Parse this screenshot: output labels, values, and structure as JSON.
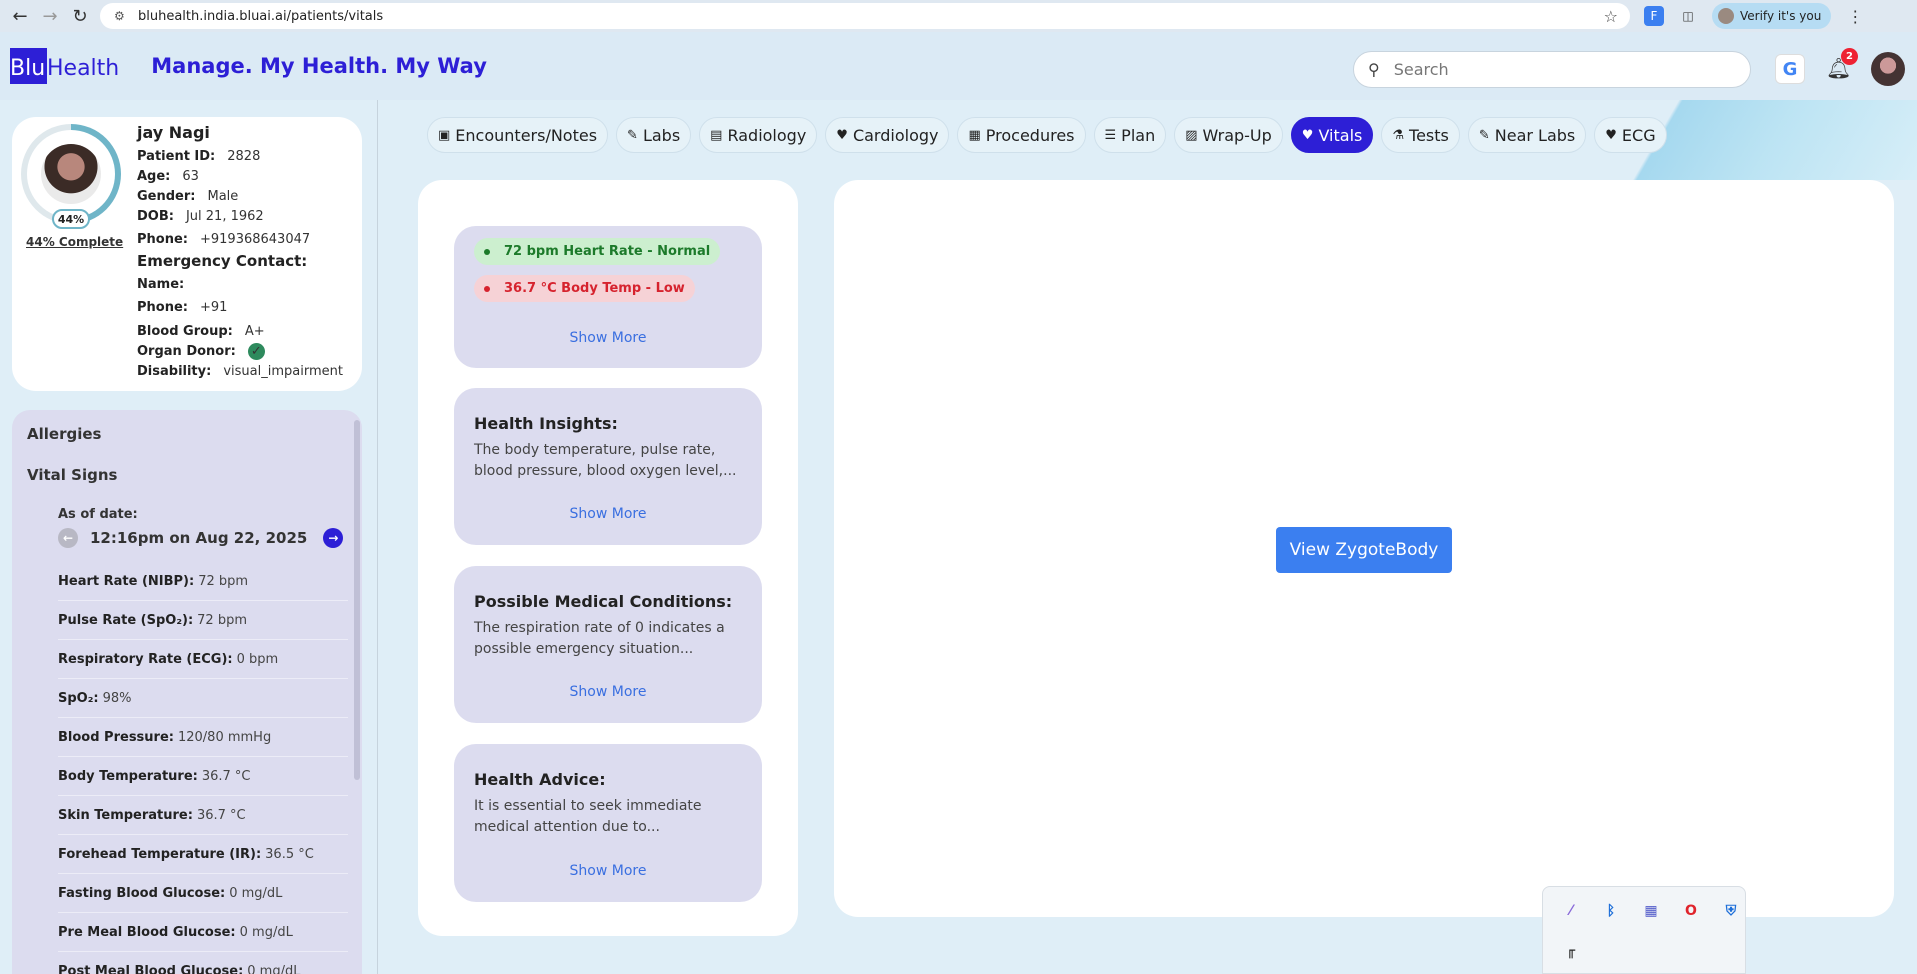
{
  "browser": {
    "url": "bluhealth.india.bluai.ai/patients/vitals",
    "profile_label": "Verify it's you"
  },
  "header": {
    "logo_blu": "Blu",
    "logo_health": "Health",
    "tagline": "Manage. My Health. My Way",
    "search_placeholder": "Search",
    "google_label": "G",
    "notification_count": "2"
  },
  "patient": {
    "name": "jay Nagi",
    "completion_pct": "44%",
    "completion_label": "44% Complete",
    "fields": [
      {
        "label": "Patient ID:",
        "value": "2828"
      },
      {
        "label": "Age:",
        "value": "63"
      },
      {
        "label": "Gender:",
        "value": "Male"
      },
      {
        "label": "DOB:",
        "value": "Jul 21, 1962"
      },
      {
        "label": "Phone:",
        "value": "+919368643047"
      }
    ],
    "emergency_heading": "Emergency Contact:",
    "emergency": [
      {
        "label": "Name:",
        "value": ""
      },
      {
        "label": "Phone:",
        "value": "+91"
      }
    ],
    "blood_group_label": "Blood Group:",
    "blood_group": "A+",
    "organ_donor_label": "Organ Donor:",
    "disability_label": "Disability:",
    "disability": "visual_impairment"
  },
  "vitals_panel": {
    "allergies_label": "Allergies",
    "vital_signs_label": "Vital Signs",
    "as_of_label": "As of date:",
    "date": "12:16pm on Aug 22, 2025",
    "rows": [
      {
        "label": "Heart Rate (NIBP):",
        "value": "72 bpm"
      },
      {
        "label": "Pulse Rate (SpO₂):",
        "value": "72 bpm"
      },
      {
        "label": "Respiratory Rate (ECG):",
        "value": "0 bpm"
      },
      {
        "label": "SpO₂:",
        "value": "98%"
      },
      {
        "label": "Blood Pressure:",
        "value": "120/80 mmHg"
      },
      {
        "label": "Body Temperature:",
        "value": "36.7 °C"
      },
      {
        "label": "Skin Temperature:",
        "value": "36.7 °C"
      },
      {
        "label": "Forehead Temperature (IR):",
        "value": "36.5 °C"
      },
      {
        "label": "Fasting Blood Glucose:",
        "value": "0 mg/dL"
      },
      {
        "label": "Pre Meal Blood Glucose:",
        "value": "0 mg/dL"
      },
      {
        "label": "Post Meal Blood Glucose:",
        "value": "0 mg/dL"
      }
    ]
  },
  "tabs": [
    {
      "label": "Encounters/Notes",
      "icon": "notes-icon",
      "glyph": "▣"
    },
    {
      "label": "Labs",
      "icon": "pencil-icon",
      "glyph": "✎"
    },
    {
      "label": "Radiology",
      "icon": "xray-icon",
      "glyph": "▤"
    },
    {
      "label": "Cardiology",
      "icon": "heart-pulse-icon",
      "glyph": "♥"
    },
    {
      "label": "Procedures",
      "icon": "bed-icon",
      "glyph": "▦"
    },
    {
      "label": "Plan",
      "icon": "list-icon",
      "glyph": "☰"
    },
    {
      "label": "Wrap-Up",
      "icon": "clipboard-check-icon",
      "glyph": "▨"
    },
    {
      "label": "Vitals",
      "icon": "heart-icon",
      "glyph": "♥"
    },
    {
      "label": "Tests",
      "icon": "flask-icon",
      "glyph": "⚗"
    },
    {
      "label": "Near Labs",
      "icon": "pencil-icon",
      "glyph": "✎"
    },
    {
      "label": "ECG",
      "icon": "heart-pulse-icon",
      "glyph": "♥"
    }
  ],
  "active_tab": "Vitals",
  "insights": {
    "status_pills": [
      {
        "text": "72 bpm Heart Rate - Normal",
        "status": "normal"
      },
      {
        "text": "36.7 °C Body Temp - Low",
        "status": "low"
      }
    ],
    "show_more": "Show More",
    "cards": [
      {
        "title": "Health Insights:",
        "text": "The body temperature, pulse rate, blood pressure, blood oxygen level,..."
      },
      {
        "title": "Possible Medical Conditions:",
        "text": "The respiration rate of 0 indicates a possible emergency situation..."
      },
      {
        "title": "Health Advice:",
        "text": "It is essential to seek immediate medical attention due to..."
      }
    ]
  },
  "zygote": {
    "button_label": "View ZygoteBody"
  },
  "colors": {
    "brand": "#2d1fd6",
    "normal": "#1c7a2a",
    "low": "#d6232e",
    "link": "#3a6fe0",
    "button": "#3b7ff0"
  }
}
